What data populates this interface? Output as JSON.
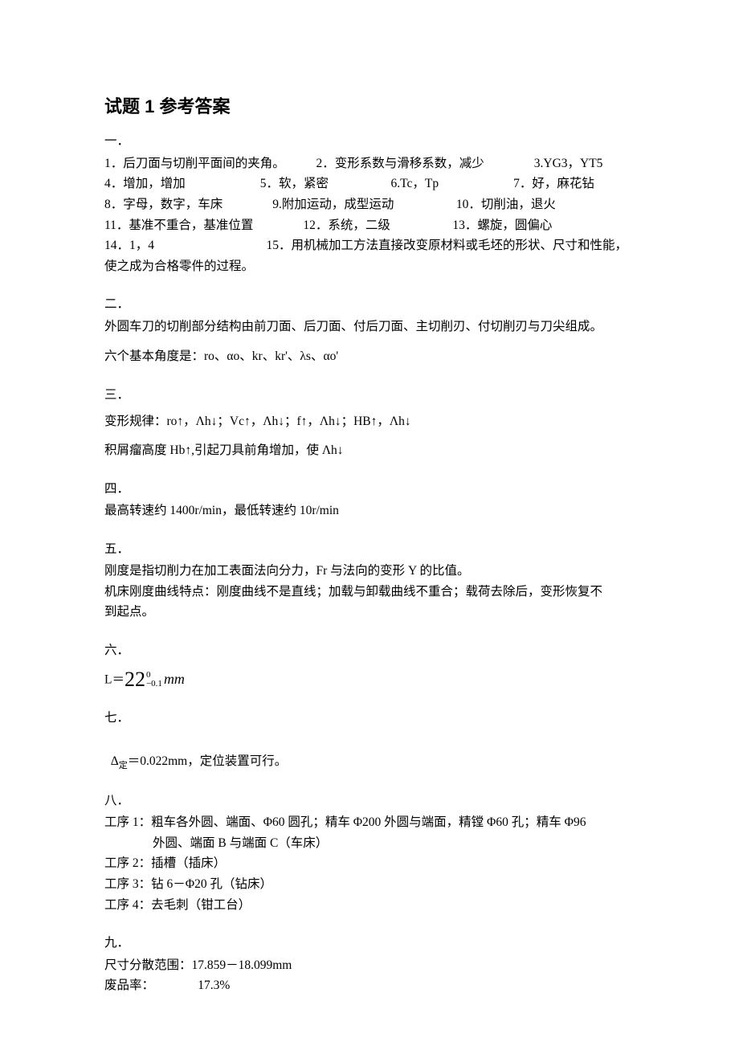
{
  "title": "试题 1 参考答案",
  "sec1": {
    "head": "一．",
    "l1": "1．后刀面与切削平面间的夹角。　　　2．变形系数与滑移系数，减少　　　　3.YG3，YT5",
    "l2": "4．增加，增加　　　　　　5．软，紧密　　　　　6.Tc，Tp　　　　　　7．好，麻花钻",
    "l3": "8．字母，数字，车床　　　　9.附加运动，成型运动　　　　　10．切削油，退火",
    "l4": "11．基准不重合，基准位置　　　　12．系统，二级　　　　　13．螺旋，圆偏心",
    "l5": "14．1，4　　　　　　　　　15．用机械加工方法直接改变原材料或毛坯的形状、尺寸和性能，",
    "l6": "使之成为合格零件的过程。"
  },
  "sec2": {
    "head": "二．",
    "l1": "外圆车刀的切削部分结构由前刀面、后刀面、付后刀面、主切削刃、付切削刃与刀尖组成。",
    "l2": "六个基本角度是：ro、αo、kr、kr'、λs、αo'"
  },
  "sec3": {
    "head": "三．",
    "l1": "变形规律：ro↑，Λh↓；Vc↑，Λh↓；f↑，Λh↓；HB↑，Λh↓",
    "l2": "积屑瘤高度 Hb↑,引起刀具前角增加，使 Λh↓"
  },
  "sec4": {
    "head": "四．",
    "l1": "最高转速约 1400r/min，最低转速约 10r/min"
  },
  "sec5": {
    "head": "五．",
    "l1": "刚度是指切削力在加工表面法向分力，Fr 与法向的变形 Y 的比值。",
    "l2": "机床刚度曲线特点：刚度曲线不是直线；加载与卸载曲线不重合；载荷去除后，变形恢复不",
    "l3": "到起点。"
  },
  "sec6": {
    "head": "六．",
    "formula": {
      "lead": "L＝",
      "big": "22",
      "sup_top": "0",
      "sup_bot": "−0.1",
      "unit": "mm"
    }
  },
  "sec7": {
    "head": "七．",
    "delta_pre": "Δ",
    "delta_sub": "定",
    "delta_rest": "＝0.022mm，定位装置可行。"
  },
  "sec8": {
    "head": "八．",
    "l1": "工序 1：粗车各外圆、端面、Φ60 圆孔；精车 Φ200 外圆与端面，精镗 Φ60 孔；精车 Φ96",
    "l1b": "外圆、端面 B 与端面 C（车床）",
    "l2": "工序 2：插槽（插床）",
    "l3": "工序 3：钻 6－Φ20 孔（钻床）",
    "l4": "工序 4：去毛刺（钳工台）"
  },
  "sec9": {
    "head": "九．",
    "l1": "尺寸分散范围：17.859－18.099mm",
    "l2": "废品率：　　　　17.3%"
  }
}
